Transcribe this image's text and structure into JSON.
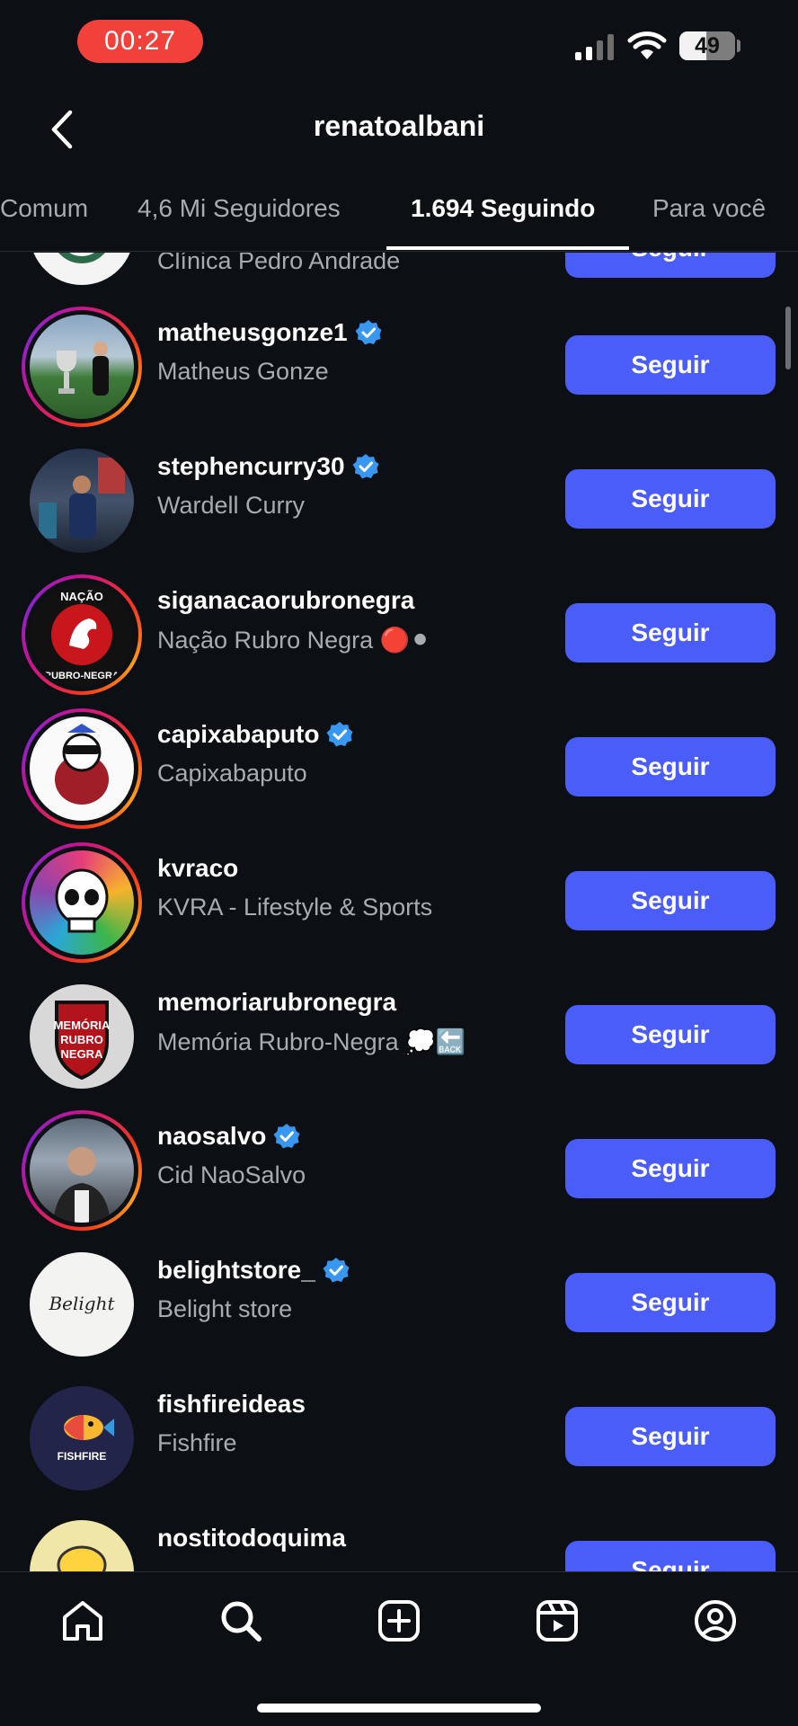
{
  "status_bar": {
    "time": "00:27",
    "battery": "49",
    "battery_level": 0.49
  },
  "header": {
    "title": "renatoalbani"
  },
  "tabs": [
    {
      "label": "Comum"
    },
    {
      "label": "4,6 Mi Seguidores"
    },
    {
      "label": "1.694 Seguindo"
    },
    {
      "label": "Para você"
    }
  ],
  "follow_label": "Seguir",
  "rows": [
    {
      "username": "",
      "fullname": "Clínica Pedro Andrade",
      "verified": false,
      "ring": false,
      "button": "Seguir"
    },
    {
      "username": "matheusgonze1",
      "fullname": "Matheus Gonze",
      "verified": true,
      "ring": true,
      "button": "Seguir"
    },
    {
      "username": "stephencurry30",
      "fullname": "Wardell Curry",
      "verified": true,
      "ring": false,
      "button": "Seguir"
    },
    {
      "username": "siganacaorubronegra",
      "fullname": "Nação Rubro Negra 🔴⚫",
      "verified": false,
      "ring": true,
      "button": "Seguir"
    },
    {
      "username": "capixabaputo",
      "fullname": "Capixabaputo",
      "verified": true,
      "ring": true,
      "button": "Seguir"
    },
    {
      "username": "kvraco",
      "fullname": "KVRA - Lifestyle & Sports",
      "verified": false,
      "ring": true,
      "button": "Seguir"
    },
    {
      "username": "memoriarubronegra",
      "fullname": "Memória Rubro-Negra 💭🔙",
      "verified": false,
      "ring": false,
      "button": "Seguir"
    },
    {
      "username": "naosalvo",
      "fullname": "Cid NaoSalvo",
      "verified": true,
      "ring": true,
      "button": "Seguir"
    },
    {
      "username": "belightstore_",
      "fullname": "Belight store",
      "verified": true,
      "ring": false,
      "button": "Seguir"
    },
    {
      "username": "fishfireideas",
      "fullname": "Fishfire",
      "verified": false,
      "ring": false,
      "button": "Seguir"
    },
    {
      "username": "nostitodoquima",
      "fullname": "",
      "verified": false,
      "ring": false,
      "button": "Seguir"
    }
  ],
  "avatar_text": {
    "nacao_top": "NAÇÃO",
    "nacao_bottom": "RUBRO-NEGRA",
    "memoria_1": "MEMÓRIA",
    "memoria_2": "RUBRO",
    "memoria_3": "NEGRA",
    "belight": "Belight",
    "fishfire": "FISHFIRE"
  },
  "nav": [
    "home-icon",
    "search-icon",
    "create-icon",
    "reels-icon",
    "profile-icon"
  ],
  "colors": {
    "background": "#0c0f14",
    "button": "#4a5df9",
    "time_pill": "#f2403b",
    "verified": "#3897f0"
  }
}
